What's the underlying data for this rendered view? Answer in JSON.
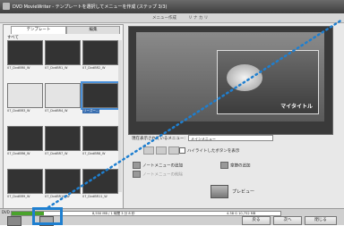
{
  "window": {
    "title": "DVD MovieWriter - テンプレートを選択してメニューを作成 (ステップ 3/3)"
  },
  "toolbar": {
    "item1": "メニュー作成",
    "item2": "リ ナ カ リ"
  },
  "left_pane": {
    "tabs": [
      "テンプレート",
      "編集"
    ],
    "category": "すべて",
    "thumbnails": [
      {
        "label": "07_DvdBR0_W",
        "style": "dark"
      },
      {
        "label": "07_DvdBR1_W",
        "style": "dark"
      },
      {
        "label": "07_DvdBR2_W",
        "style": "dark"
      },
      {
        "label": "07_DvdBR3_W",
        "style": "light"
      },
      {
        "label": "07_DvdBR4_W",
        "style": "light"
      },
      {
        "label": "リーズー...",
        "style": "dark",
        "selected": true
      },
      {
        "label": "07_DvdBR6_W",
        "style": "dark"
      },
      {
        "label": "07_DvdBR7_W",
        "style": "dark"
      },
      {
        "label": "07_DvdBR8_W",
        "style": "dark"
      },
      {
        "label": "07_DvdBR9_W",
        "style": "dark"
      },
      {
        "label": "07_DvdBR10_W",
        "style": "dark"
      },
      {
        "label": "07_DvdBR11_W",
        "style": "dark"
      }
    ],
    "bottom_text": "DVD"
  },
  "preview": {
    "title_text": "マイタイトル"
  },
  "controls": {
    "current_label": "現在表示されているメニュー:",
    "current_value": "メインメニュー",
    "highlight_checkbox": "ハイライトしたボタンを表示",
    "add_menu": "ノートメニューの追加",
    "delete_menu": "ノートメニューの削除",
    "add_chapter": "章節の追加",
    "preview_label": "プレビュー"
  },
  "footer": {
    "capacity_text": "8,550 MB / 1 時間 3 分 8 秒",
    "remaining_text": "4.38 G 10,752 MB",
    "capacity_fraction": 0.12,
    "back_button": "戻る",
    "next_button": "次へ",
    "close_button": "閉じる"
  }
}
